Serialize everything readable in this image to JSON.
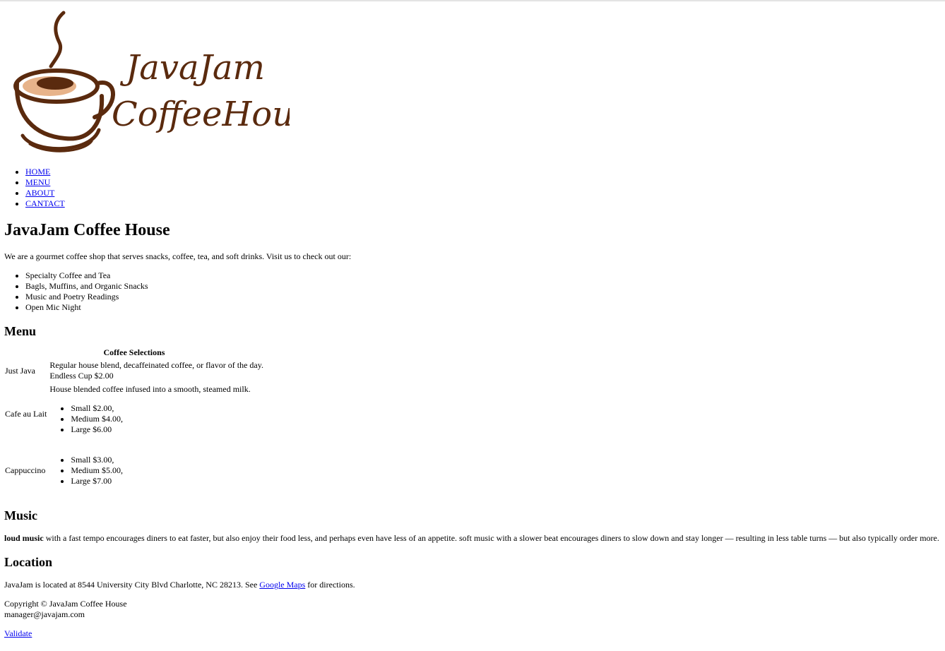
{
  "logo": {
    "line1": "JavaJam",
    "line2": "CoffeeHouse",
    "colors": {
      "brown": "#5a2a0e",
      "cream": "#e7b38a"
    }
  },
  "nav": [
    {
      "label": "HOME"
    },
    {
      "label": "MENU"
    },
    {
      "label": "ABOUT"
    },
    {
      "label": "CANTACT"
    }
  ],
  "main": {
    "title": "JavaJam Coffee House",
    "intro": "We are a gourmet coffee shop that serves snacks, coffee, tea, and soft drinks. Visit us to check out our:",
    "features": [
      "Specialty Coffee and Tea",
      "Bagls, Muffins, and Organic Snacks",
      "Music and Poetry Readings",
      "Open Mic Night"
    ]
  },
  "menu": {
    "heading": "Menu",
    "caption": "Coffee Selections",
    "rows": [
      {
        "name": "Just Java",
        "lines": [
          "Regular house blend, decaffeinated coffee, or flavor of the day.",
          "Endless Cup $2.00"
        ]
      },
      {
        "name": "Cafe au Lait",
        "desc": "House blended coffee infused into a smooth, steamed milk.",
        "prices": [
          "Small $2.00,",
          "Medium $4.00,",
          "Large $6.00"
        ]
      },
      {
        "name": "Cappuccino",
        "prices": [
          "Small $3.00,",
          "Medium $5.00,",
          "Large $7.00"
        ]
      }
    ]
  },
  "music": {
    "heading": "Music",
    "bold": "loud music",
    "text": " with a fast tempo encourages diners to eat faster, but also enjoy their food less, and perhaps even have less of an appetite. soft music with a slower beat encourages diners to slow down and stay longer — resulting in less table turns — but also typically order more."
  },
  "location": {
    "heading": "Location",
    "text_before": "JavaJam is located at 8544 University City Blvd Charlotte, NC 28213. See ",
    "link": "Google Maps",
    "text_after": " for directions."
  },
  "footer": {
    "copyright": "Copyright © JavaJam Coffee House",
    "email": "manager@javajam.com",
    "validate": "Validate"
  }
}
